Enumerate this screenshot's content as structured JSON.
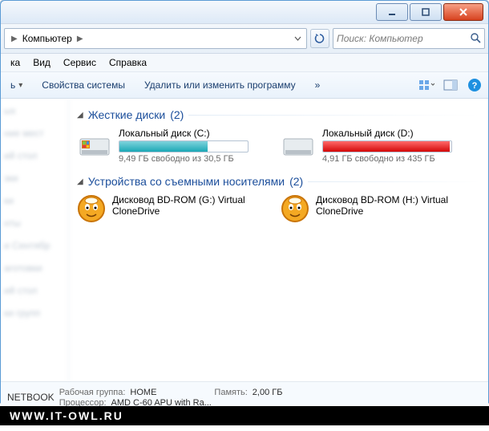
{
  "breadcrumb": {
    "item": "Компьютер"
  },
  "search": {
    "placeholder": "Поиск: Компьютер"
  },
  "menu": {
    "view": "Вид",
    "service": "Сервис",
    "help": "Справка"
  },
  "toolbar": {
    "properties": "Свойства системы",
    "uninstall": "Удалить или изменить программу",
    "overflow": "»"
  },
  "groups": {
    "hdd": {
      "title": "Жесткие диски",
      "count": "(2)"
    },
    "removable": {
      "title": "Устройства со съемными носителями",
      "count": "(2)"
    }
  },
  "drives": [
    {
      "name": "Локальный диск (C:)",
      "free": "9,49 ГБ свободно из 30,5 ГБ",
      "fill_pct": 69,
      "color": "teal"
    },
    {
      "name": "Локальный диск (D:)",
      "free": "4,91 ГБ свободно из 435 ГБ",
      "fill_pct": 99,
      "color": "red"
    }
  ],
  "removables": [
    {
      "name": "Дисковод BD-ROM (G:) Virtual CloneDrive"
    },
    {
      "name": "Дисковод BD-ROM (H:) Virtual CloneDrive"
    }
  ],
  "status": {
    "computer": "NETBOOK",
    "workgroup_label": "Рабочая группа:",
    "workgroup": "HOME",
    "memory_label": "Память:",
    "memory": "2,00 ГБ",
    "cpu_label": "Процессор:",
    "cpu": "AMD C-60 APU with Ra..."
  },
  "sidebar_items": [
    "ых",
    "ние мест",
    "ий стол",
    "зки",
    "ки",
    "нты",
    "и Сентябр",
    "аготовки",
    "ий стол",
    "ки групп"
  ],
  "watermark": "WWW.IT-OWL.RU"
}
